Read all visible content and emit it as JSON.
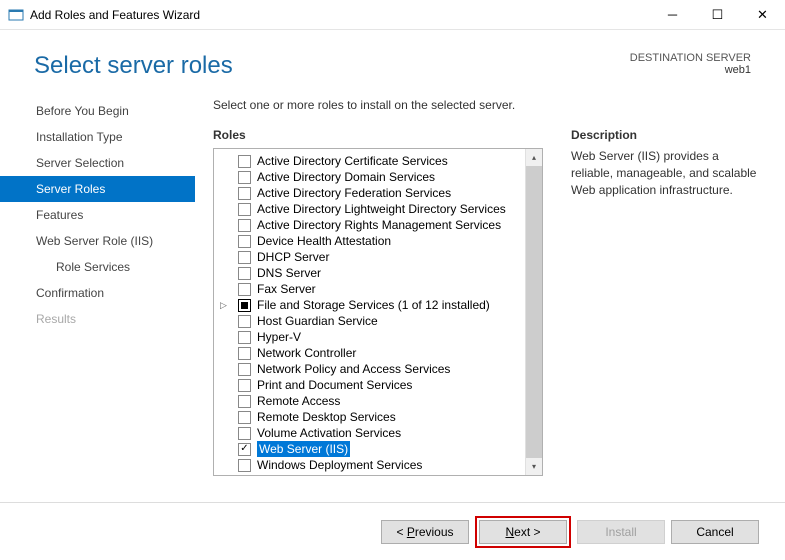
{
  "window": {
    "title": "Add Roles and Features Wizard"
  },
  "header": {
    "title": "Select server roles",
    "dest_label": "DESTINATION SERVER",
    "dest_value": "web1"
  },
  "sidebar": {
    "steps": [
      {
        "label": "Before You Begin",
        "active": false
      },
      {
        "label": "Installation Type",
        "active": false
      },
      {
        "label": "Server Selection",
        "active": false
      },
      {
        "label": "Server Roles",
        "active": true
      },
      {
        "label": "Features",
        "active": false
      },
      {
        "label": "Web Server Role (IIS)",
        "active": false
      },
      {
        "label": "Role Services",
        "active": false,
        "sub": true
      },
      {
        "label": "Confirmation",
        "active": false
      },
      {
        "label": "Results",
        "active": false,
        "disabled": true
      }
    ]
  },
  "main": {
    "instruction": "Select one or more roles to install on the selected server.",
    "roles_label": "Roles",
    "roles": [
      {
        "label": "Active Directory Certificate Services"
      },
      {
        "label": "Active Directory Domain Services"
      },
      {
        "label": "Active Directory Federation Services"
      },
      {
        "label": "Active Directory Lightweight Directory Services"
      },
      {
        "label": "Active Directory Rights Management Services"
      },
      {
        "label": "Device Health Attestation"
      },
      {
        "label": "DHCP Server"
      },
      {
        "label": "DNS Server"
      },
      {
        "label": "Fax Server"
      },
      {
        "label": "File and Storage Services (1 of 12 installed)",
        "partial": true,
        "expandable": true
      },
      {
        "label": "Host Guardian Service"
      },
      {
        "label": "Hyper-V"
      },
      {
        "label": "Network Controller"
      },
      {
        "label": "Network Policy and Access Services"
      },
      {
        "label": "Print and Document Services"
      },
      {
        "label": "Remote Access"
      },
      {
        "label": "Remote Desktop Services"
      },
      {
        "label": "Volume Activation Services"
      },
      {
        "label": "Web Server (IIS)",
        "checked": true,
        "selected": true
      },
      {
        "label": "Windows Deployment Services"
      }
    ],
    "desc_label": "Description",
    "desc_text": "Web Server (IIS) provides a reliable, manageable, and scalable Web application infrastructure."
  },
  "footer": {
    "previous": "< Previous",
    "next": "Next >",
    "install": "Install",
    "cancel": "Cancel"
  }
}
